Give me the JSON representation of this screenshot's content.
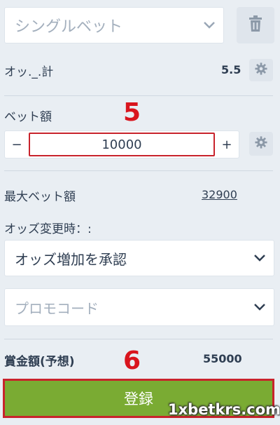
{
  "bet_type": {
    "selected": "シングルベット"
  },
  "odds": {
    "label": "オッ._.計",
    "value": "5.5"
  },
  "stake": {
    "label": "ベット額",
    "value": "10000",
    "minus": "−",
    "plus": "+"
  },
  "max_bet": {
    "label": "最大ベット額",
    "value": "32900"
  },
  "odds_change": {
    "label": "オッズ変更時：:",
    "selected": "オッズ増加を承認"
  },
  "promo": {
    "placeholder": "プロモコード"
  },
  "payout": {
    "label": "賞金額(予想)",
    "value": "55000"
  },
  "register_button": {
    "label": "登録"
  },
  "annotations": {
    "step5": "5",
    "step6": "6"
  },
  "watermark": "1xbetkrs.com",
  "colors": {
    "background": "#e9eef3",
    "register_green": "#7aab33",
    "annotation_red": "#d9151e"
  },
  "icons": [
    "trash-icon",
    "chevron-down-icon",
    "gear-icon"
  ]
}
